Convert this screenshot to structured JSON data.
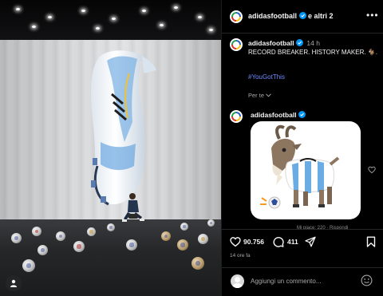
{
  "header": {
    "username": "adidasfootball",
    "others": "e altri 2",
    "more_icon": "more-horizontal-icon"
  },
  "caption": {
    "username": "adidasfootball",
    "time": "14 h",
    "text": "RECORD BREAKER. HISTORY MAKER. 🐐.",
    "hashtag": "#YouGotThis",
    "per_te": "Per te",
    "chevron_icon": "chevron-down-icon"
  },
  "comment": {
    "username": "adidasfootball",
    "meta": "Mi piace: 220 · Rispondi",
    "sticker_icon": "goat-sticker"
  },
  "actions": {
    "likes": "90.756",
    "comments": "411",
    "time_ago": "14 ore fa",
    "icons": [
      "heart-icon",
      "comment-icon",
      "share-icon",
      "bookmark-icon"
    ]
  },
  "composer": {
    "placeholder": "Aggiungi un commento...",
    "emoji_icon": "smiley-icon"
  },
  "colors": {
    "background": "#000000",
    "link": "#6f8bff",
    "verified": "#0095f6",
    "muted": "#a8a8a8"
  }
}
